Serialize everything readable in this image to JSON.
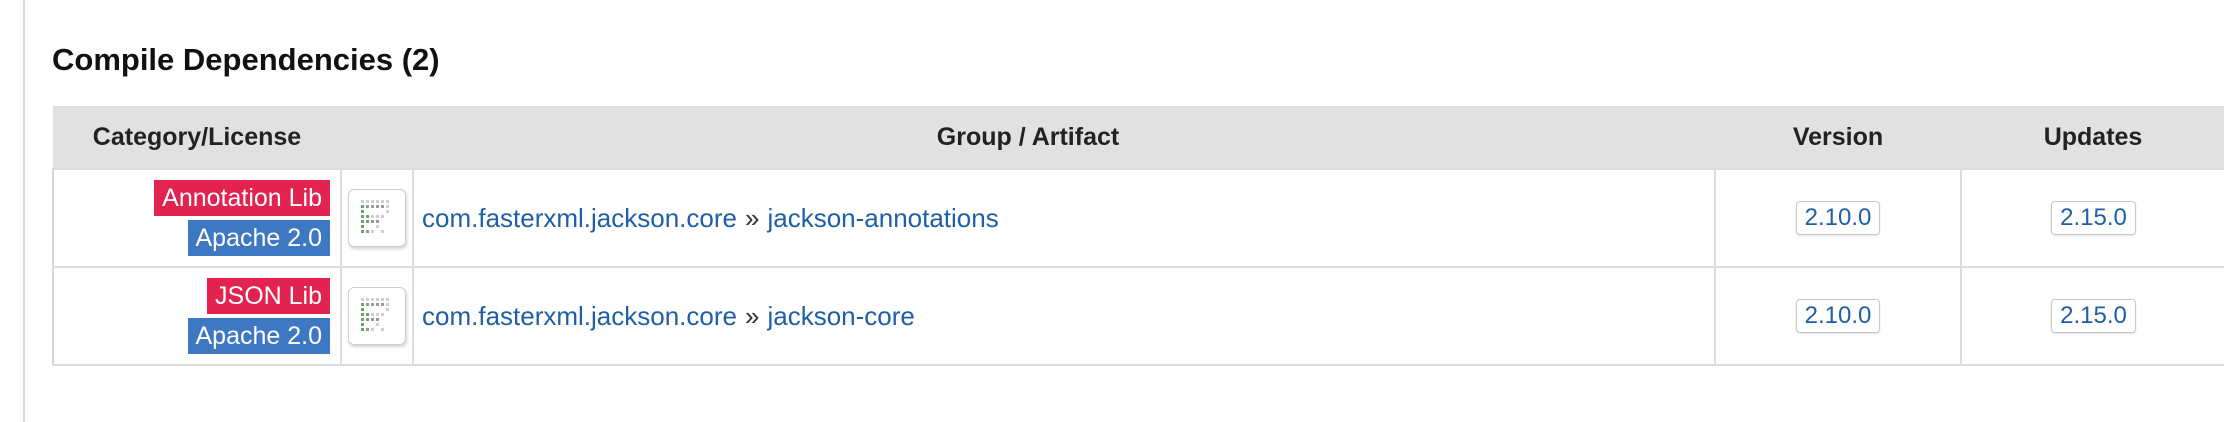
{
  "section": {
    "title": "Compile Dependencies (2)"
  },
  "table": {
    "headers": {
      "category": "Category/License",
      "artifact": "Group / Artifact",
      "version": "Version",
      "updates": "Updates"
    },
    "rows": [
      {
        "category": "Annotation Lib",
        "license": "Apache 2.0",
        "group": "com.fasterxml.jackson.core",
        "separator": "»",
        "artifact": "jackson-annotations",
        "version": "2.10.0",
        "update": "2.15.0"
      },
      {
        "category": "JSON Lib",
        "license": "Apache 2.0",
        "group": "com.fasterxml.jackson.core",
        "separator": "»",
        "artifact": "jackson-core",
        "version": "2.10.0",
        "update": "2.15.0"
      }
    ]
  },
  "colors": {
    "category_badge": "#e2234f",
    "license_badge": "#3f78c2",
    "link": "#1f5fa8",
    "header_bg": "#e1e1e1"
  },
  "icons": {
    "artifact_logo": "artifact-logo-icon"
  }
}
